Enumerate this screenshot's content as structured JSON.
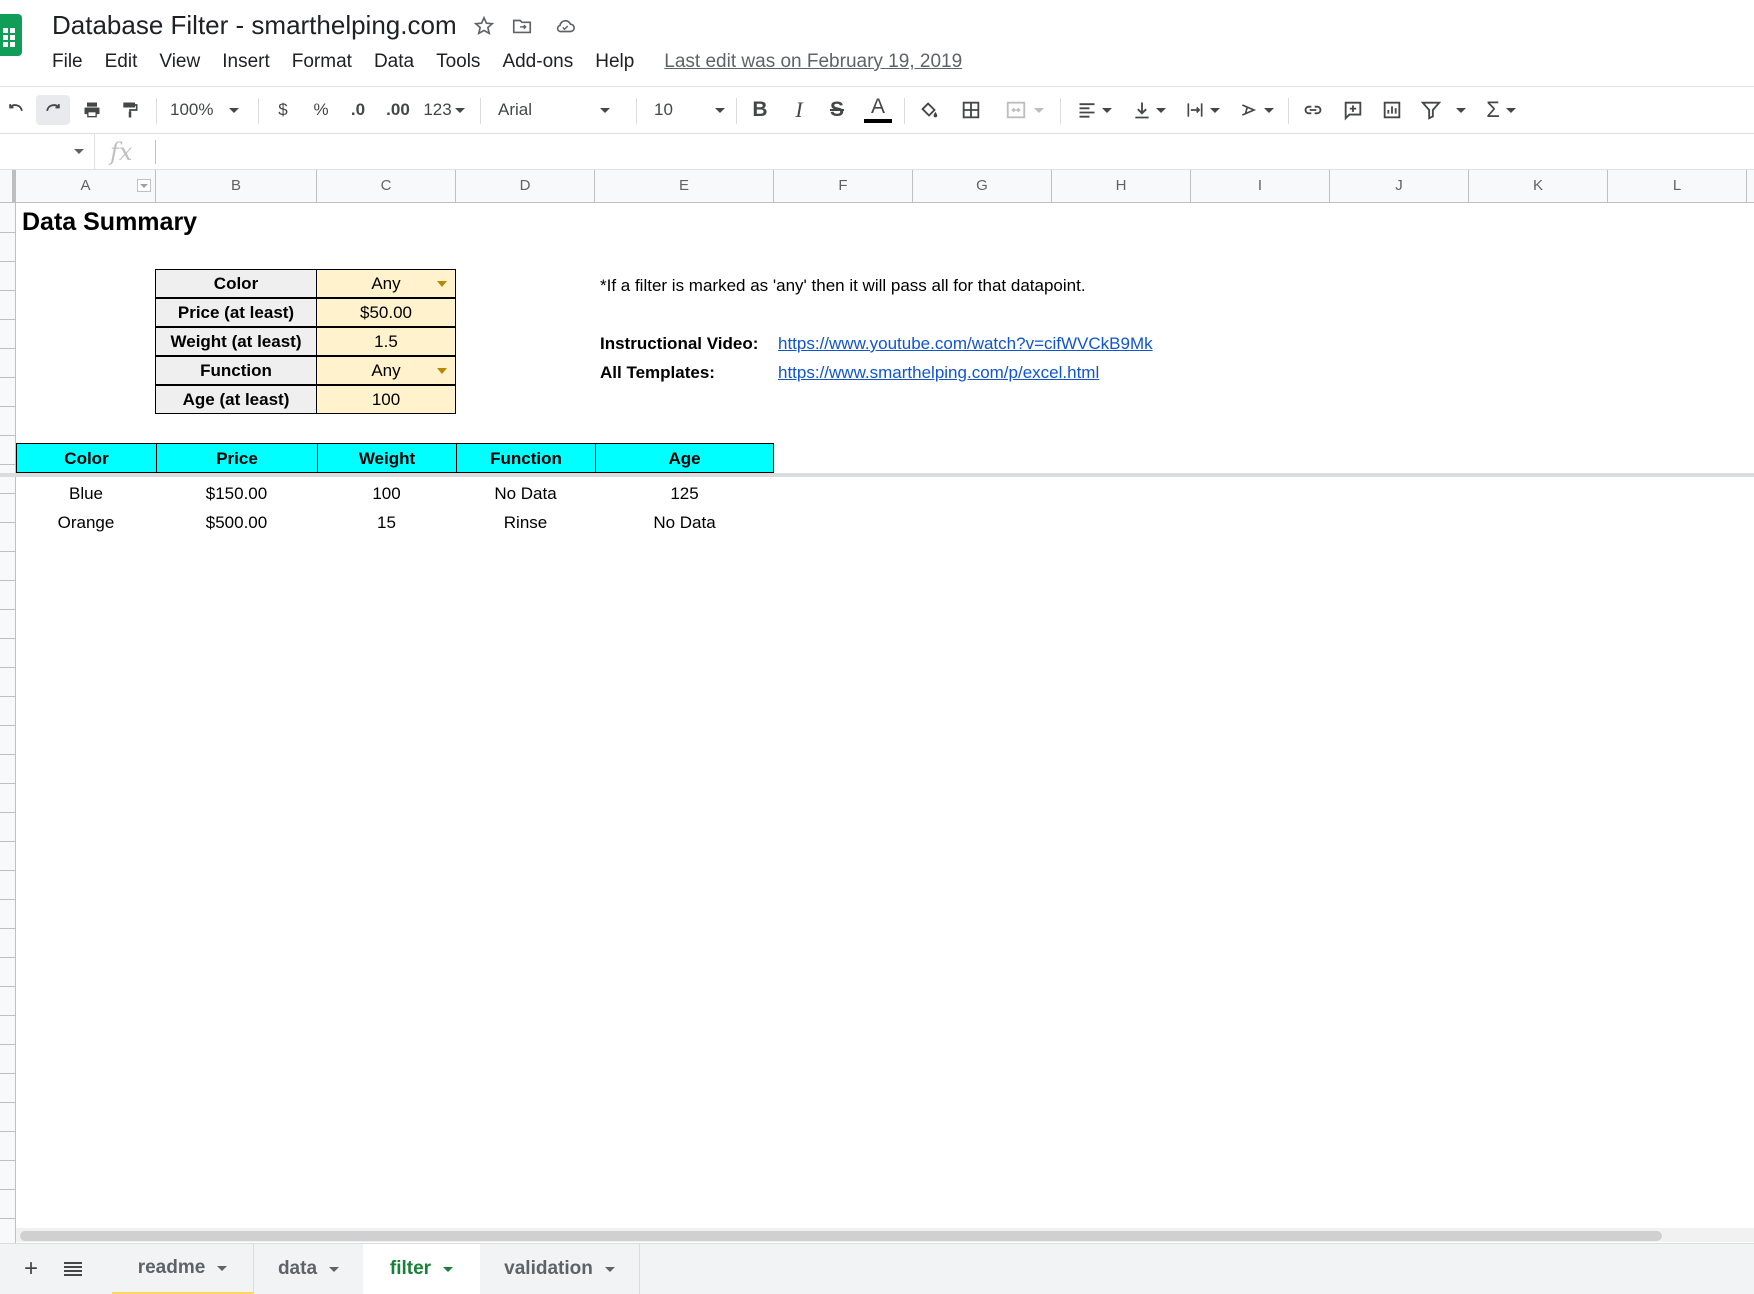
{
  "window": {
    "doc_title": "Database Filter - smarthelping.com",
    "last_edit": "Last edit was on February 19, 2019"
  },
  "menu": [
    "File",
    "Edit",
    "View",
    "Insert",
    "Format",
    "Data",
    "Tools",
    "Add-ons",
    "Help"
  ],
  "toolbar": {
    "zoom": "100%",
    "currency": "$",
    "percent": "%",
    "decrease_decimal": ".0",
    "increase_decimal": ".00",
    "number_format": "123",
    "font": "Arial",
    "font_size": "10",
    "bold": "B",
    "italic": "I",
    "strike": "S",
    "text_color": "A",
    "sum": "Σ"
  },
  "formula_bar": {
    "fx": "fx"
  },
  "columns": [
    "A",
    "B",
    "C",
    "D",
    "E",
    "F",
    "G",
    "H",
    "I",
    "J",
    "K",
    "L"
  ],
  "sheet": {
    "title": "Data Summary",
    "filters": [
      {
        "label": "Color",
        "value": "Any",
        "dropdown": true
      },
      {
        "label": "Price (at least)",
        "value": "$50.00",
        "dropdown": false
      },
      {
        "label": "Weight (at least)",
        "value": "1.5",
        "dropdown": false
      },
      {
        "label": "Function",
        "value": "Any",
        "dropdown": true
      },
      {
        "label": "Age (at least)",
        "value": "100",
        "dropdown": false
      }
    ],
    "note": "*If a filter is marked as 'any' then it will pass all for that datapoint.",
    "video_label": "Instructional Video:",
    "video_link": "https://www.youtube.com/watch?v=cifWVCkB9Mk",
    "templates_label": "All Templates:",
    "templates_link": "https://www.smarthelping.com/p/excel.html",
    "results_headers": [
      "Color",
      "Price",
      "Weight",
      "Function",
      "Age"
    ],
    "results_rows": [
      [
        "Blue",
        "$150.00",
        "100",
        "No Data",
        "125"
      ],
      [
        "Orange",
        "$500.00",
        "15",
        "Rinse",
        "No Data"
      ]
    ]
  },
  "tabs": [
    {
      "label": "readme",
      "active": false
    },
    {
      "label": "data",
      "active": false
    },
    {
      "label": "filter",
      "active": true
    },
    {
      "label": "validation",
      "active": false
    }
  ],
  "colors": {
    "filter_label_bg": "#efefef",
    "filter_value_bg": "#fff2cc",
    "results_header_bg": "#00ffff",
    "link": "#1155cc",
    "active_tab": "#188038"
  }
}
